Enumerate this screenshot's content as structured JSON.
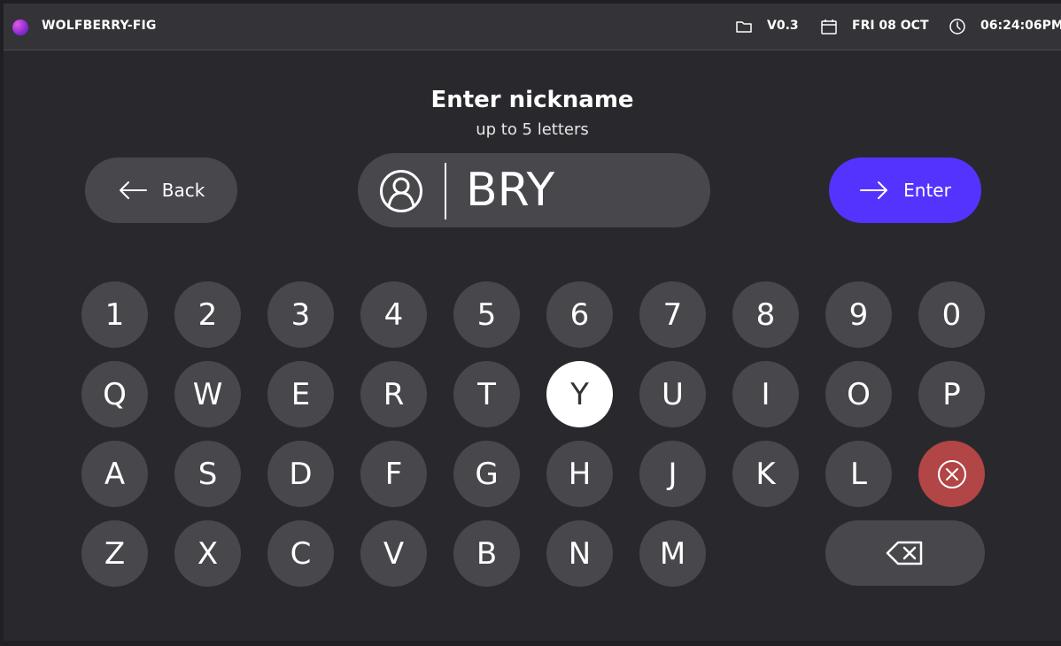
{
  "header": {
    "app_name": "WOLFBERRY-FIG",
    "version": "V0.3",
    "date": "FRI 08 OCT",
    "time": "06:24:06PM"
  },
  "prompt": {
    "title": "Enter nickname",
    "subtitle": "up to 5 letters"
  },
  "nickname_field": {
    "value": "BRY"
  },
  "buttons": {
    "back_label": "Back",
    "enter_label": "Enter"
  },
  "keyboard": {
    "active_key": "Y",
    "rows": [
      [
        "1",
        "2",
        "3",
        "4",
        "5",
        "6",
        "7",
        "8",
        "9",
        "0"
      ],
      [
        "Q",
        "W",
        "E",
        "R",
        "T",
        "Y",
        "U",
        "I",
        "O",
        "P"
      ],
      [
        "A",
        "S",
        "D",
        "F",
        "G",
        "H",
        "J",
        "K",
        "L"
      ],
      [
        "Z",
        "X",
        "C",
        "V",
        "B",
        "N",
        "M"
      ]
    ]
  },
  "colors": {
    "accent": "#5533ff",
    "danger": "#b24545",
    "key_bg": "#47474c",
    "background": "#29292d"
  }
}
